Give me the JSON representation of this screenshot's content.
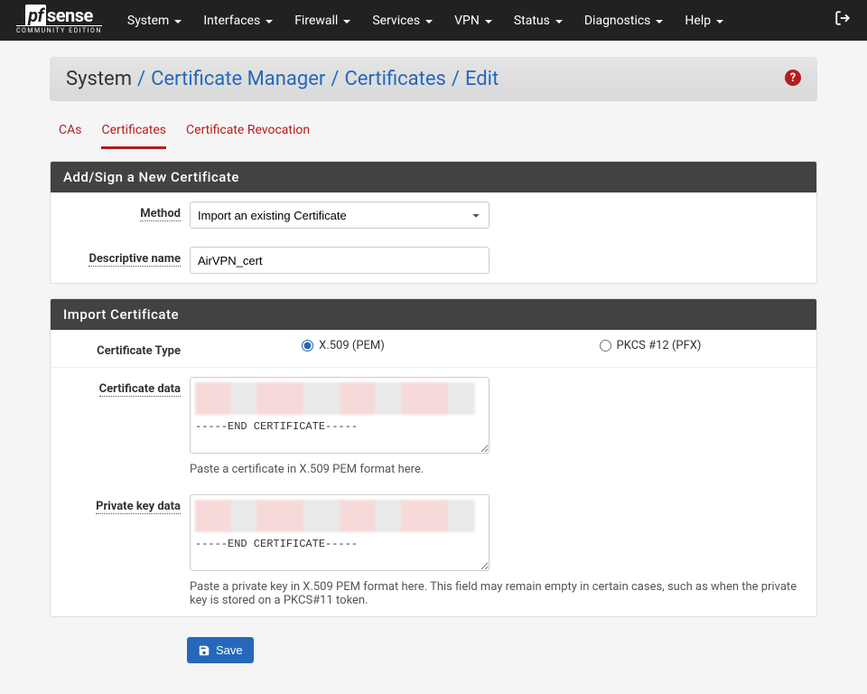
{
  "nav": {
    "items": [
      "System",
      "Interfaces",
      "Firewall",
      "Services",
      "VPN",
      "Status",
      "Diagnostics",
      "Help"
    ]
  },
  "breadcrumb": {
    "a": "System",
    "b": "Certificate Manager",
    "c": "Certificates",
    "d": "Edit"
  },
  "tabs": {
    "a": "CAs",
    "b": "Certificates",
    "c": "Certificate Revocation"
  },
  "panel1": {
    "title": "Add/Sign a New Certificate",
    "method_label": "Method",
    "method_value": "Import an existing Certificate",
    "name_label": "Descriptive name",
    "name_value": "AirVPN_cert"
  },
  "panel2": {
    "title": "Import Certificate",
    "cert_type_label": "Certificate Type",
    "radio_x509": "X.509 (PEM)",
    "radio_pfx": "PKCS #12 (PFX)",
    "cert_data_label": "Certificate data",
    "cert_end": "-----END CERTIFICATE-----",
    "cert_help": "Paste a certificate in X.509 PEM format here.",
    "key_data_label": "Private key data",
    "key_end": "-----END CERTIFICATE-----",
    "key_help": "Paste a private key in X.509 PEM format here. This field may remain empty in certain cases, such as when the private key is stored on a PKCS#11 token."
  },
  "save_label": "Save"
}
